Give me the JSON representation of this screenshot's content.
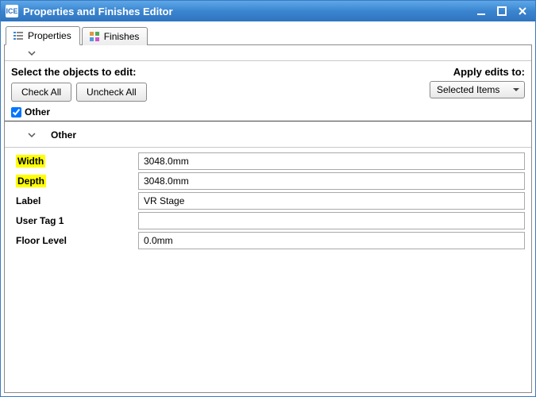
{
  "window": {
    "app_icon_text": "ICE",
    "title": "Properties and Finishes Editor"
  },
  "tabs": {
    "properties": "Properties",
    "finishes": "Finishes"
  },
  "select": {
    "prompt": "Select the objects to edit:",
    "check_all": "Check All",
    "uncheck_all": "Uncheck All",
    "apply_label": "Apply edits to:",
    "apply_value": "Selected Items"
  },
  "group": {
    "other_checkbox_label": "Other",
    "section_title": "Other"
  },
  "props": {
    "width": {
      "label": "Width",
      "value": "3048.0mm",
      "highlight": true
    },
    "depth": {
      "label": "Depth",
      "value": "3048.0mm",
      "highlight": true
    },
    "label": {
      "label": "Label",
      "value": "VR Stage",
      "highlight": false
    },
    "tag1": {
      "label": "User Tag 1",
      "value": "",
      "highlight": false
    },
    "floor": {
      "label": "Floor Level",
      "value": "0.0mm",
      "highlight": false
    }
  }
}
